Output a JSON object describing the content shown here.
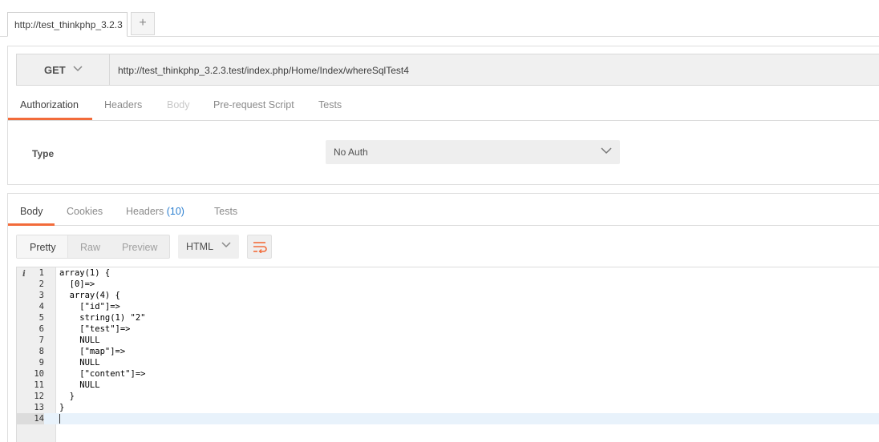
{
  "tabs": {
    "request_tab_title": "http://test_thinkphp_3.2.3",
    "new_tab_label": "+"
  },
  "request": {
    "method": "GET",
    "url": "http://test_thinkphp_3.2.3.test/index.php/Home/Index/whereSqlTest4",
    "tabs": [
      {
        "label": "Authorization",
        "state": "active"
      },
      {
        "label": "Headers",
        "state": "normal"
      },
      {
        "label": "Body",
        "state": "disabled"
      },
      {
        "label": "Pre-request Script",
        "state": "normal"
      },
      {
        "label": "Tests",
        "state": "normal"
      }
    ],
    "auth": {
      "type_label": "Type",
      "selected": "No Auth"
    }
  },
  "response": {
    "tabs": [
      {
        "label": "Body"
      },
      {
        "label": "Cookies"
      },
      {
        "label": "Headers",
        "count": "(10)"
      },
      {
        "label": "Tests"
      }
    ],
    "format_buttons": [
      "Pretty",
      "Raw",
      "Preview"
    ],
    "language": "HTML",
    "info_marker": "i",
    "lines": [
      "array(1) {",
      "  [0]=>",
      "  array(4) {",
      "    [\"id\"]=>",
      "    string(1) \"2\"",
      "    [\"test\"]=>",
      "    NULL",
      "    [\"map\"]=>",
      "    NULL",
      "    [\"content\"]=>",
      "    NULL",
      "  }",
      "}",
      ""
    ],
    "line_numbers": [
      "1",
      "2",
      "3",
      "4",
      "5",
      "6",
      "7",
      "8",
      "9",
      "10",
      "11",
      "12",
      "13",
      "14"
    ]
  },
  "colors": {
    "accent": "#f26b3a",
    "count_blue": "#2a7ed0"
  }
}
